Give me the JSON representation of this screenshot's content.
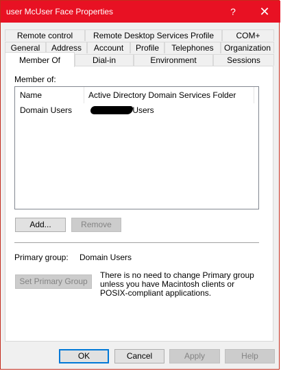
{
  "window": {
    "title": "user McUser Face Properties",
    "help_glyph": "?",
    "close_glyph": "✕"
  },
  "tabs": {
    "row1": [
      "Remote control",
      "Remote Desktop Services Profile",
      "COM+"
    ],
    "row2": [
      "General",
      "Address",
      "Account",
      "Profile",
      "Telephones",
      "Organization"
    ],
    "row3": [
      "Member Of",
      "Dial-in",
      "Environment",
      "Sessions"
    ],
    "active": "Member Of"
  },
  "member_of": {
    "label": "Member of:",
    "columns": [
      "Name",
      "Active Directory Domain Services Folder"
    ],
    "rows": [
      {
        "name": "Domain Users",
        "folder": "/Users",
        "folder_redacted": true
      }
    ],
    "add_button": "Add...",
    "remove_button": "Remove"
  },
  "primary_group": {
    "label": "Primary group:",
    "value": "Domain Users",
    "set_button": "Set Primary Group",
    "note": "There is no need to change Primary group unless you have Macintosh clients or POSIX-compliant applications."
  },
  "footer": {
    "ok": "OK",
    "cancel": "Cancel",
    "apply": "Apply",
    "help": "Help"
  },
  "colors": {
    "titlebar": "#e81123",
    "focus_border": "#0078d7"
  }
}
